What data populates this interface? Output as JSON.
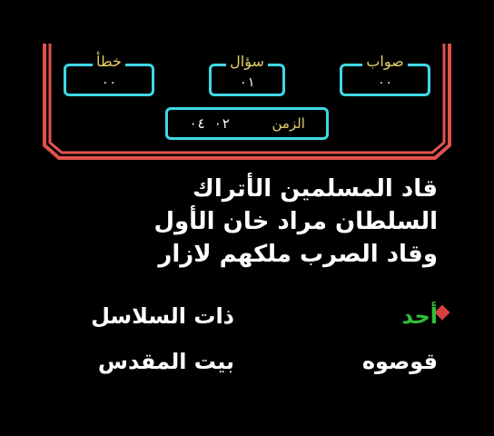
{
  "hud": {
    "wrong": {
      "label": "خطأ",
      "value": "٠٠"
    },
    "question": {
      "label": "سؤال",
      "value": "٠١"
    },
    "correct": {
      "label": "صواب",
      "value": "٠٠"
    },
    "time": {
      "label": "الزمن",
      "value": "٠٢ ٠٤"
    }
  },
  "question": {
    "lines": [
      "قاد المسلمين الأتراك",
      "السلطان مراد خان الأول",
      "وقاد الصرب ملكهم لازار"
    ]
  },
  "options": [
    {
      "label": "أحد",
      "selected": true
    },
    {
      "label": "ذات السلاسل",
      "selected": false
    },
    {
      "label": "قوصوه",
      "selected": false
    },
    {
      "label": "بيت المقدس",
      "selected": false
    }
  ],
  "colors": {
    "frame": "#e2524c",
    "hud_border": "#3fd8e6",
    "hud_label": "#e3d06a",
    "selected_option": "#2fbf3a",
    "cursor": "#d84040"
  }
}
